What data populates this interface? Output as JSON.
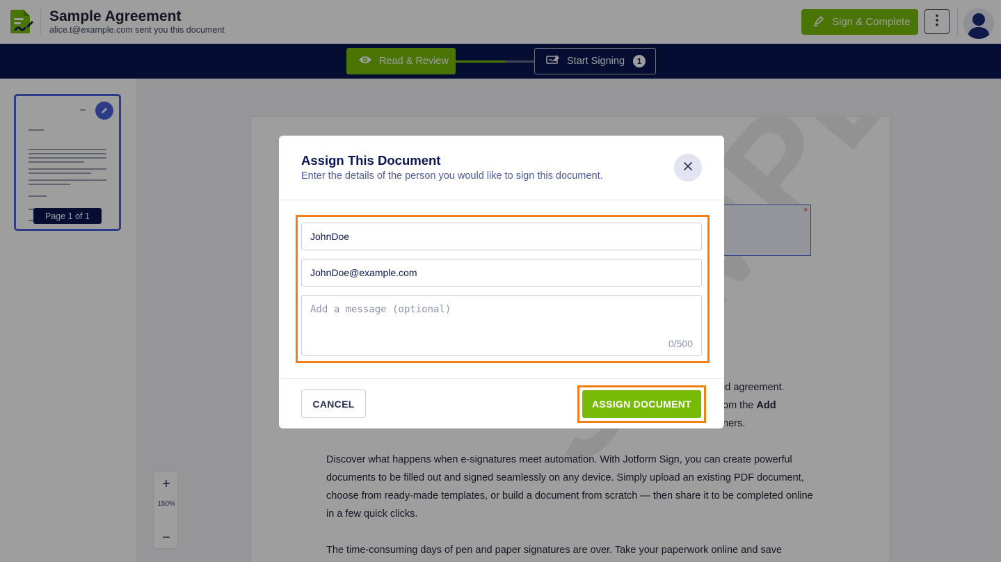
{
  "header": {
    "title": "Sample Agreement",
    "subtitle": "alice.t@example.com sent you this document",
    "sign_complete_label": "Sign & Complete"
  },
  "steps": {
    "read_review_label": "Read & Review",
    "start_signing_label": "Start Signing",
    "start_signing_count": "1"
  },
  "sidebar": {
    "page_label": "Page 1 of 1"
  },
  "document": {
    "frag_line1": "id agreement.",
    "frag_line2_pre": "om the ",
    "frag_line2_bold": "Add",
    "frag_line3": "ners.",
    "paragraph1": "Discover what happens when e-signatures meet automation. With Jotform Sign, you can create powerful documents to be filled out and signed seamlessly on any device. Simply upload an existing PDF document, choose from ready-made templates, or build a document from scratch — then share it to be completed online in a few quick clicks.",
    "paragraph2": "The time-consuming days of pen and paper signatures are over. Take your paperwork online and save",
    "watermark": "SAMPLE PDF"
  },
  "zoom": {
    "zoom_in": "+",
    "level": "150%",
    "zoom_out": "−"
  },
  "modal": {
    "title": "Assign This Document",
    "subtitle": "Enter the details of the person you would like to sign this document.",
    "name_value": "JohnDoe",
    "email_value": "JohnDoe@example.com",
    "message_placeholder": "Add a message (optional)",
    "message_counter": "0/500",
    "cancel_label": "CANCEL",
    "assign_label": "ASSIGN DOCUMENT"
  },
  "colors": {
    "brand_green": "#78bb07",
    "navy": "#0a1551",
    "highlight_orange": "#f07f15",
    "accent_blue": "#4a62d8"
  }
}
